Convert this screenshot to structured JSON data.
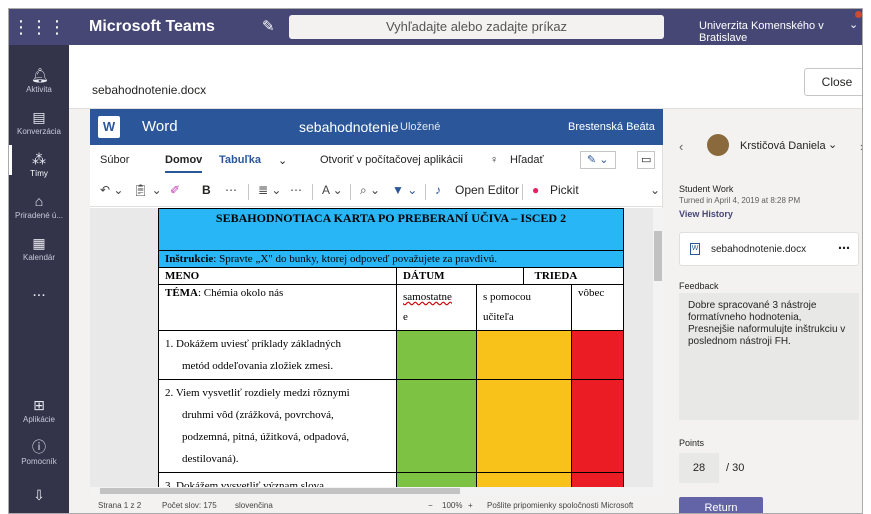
{
  "topbar": {
    "app_title": "Microsoft Teams",
    "search_placeholder": "Vyhľadajte alebo zadajte príkaz",
    "org_name": "Univerzita Komenského v Bratislave"
  },
  "rail": [
    {
      "label": "Aktivita",
      "icon": "bell-icon"
    },
    {
      "label": "Konverzácia",
      "icon": "chat-icon"
    },
    {
      "label": "Tímy",
      "icon": "teams-icon"
    },
    {
      "label": "Priradené ú...",
      "icon": "assignments-icon"
    },
    {
      "label": "Kalendár",
      "icon": "calendar-icon"
    },
    {
      "label": "...",
      "icon": "more-icon"
    },
    {
      "label": "Aplikácie",
      "icon": "apps-icon"
    },
    {
      "label": "Pomocník",
      "icon": "help-icon"
    }
  ],
  "file_header": {
    "filename": "sebahodnotenie.docx",
    "close_label": "Close"
  },
  "word": {
    "app_name": "Word",
    "doc_name": "sebahodnotenie",
    "saved_state": "Uložené",
    "user_name": "Brestenská Beáta",
    "menu": {
      "file": "Súbor",
      "home": "Domov",
      "table": "Tabuľka",
      "open_desktop": "Otvoriť v počítačovej aplikácii",
      "search": "Hľadať"
    },
    "toolbar": {
      "bold": "B",
      "open_editor": "Open Editor",
      "pickit": "Pickit"
    },
    "status": {
      "page": "Strana 1 z 2",
      "words": "Počet slov: 175",
      "language": "slovenčina",
      "zoom": "100%",
      "feedback": "Pošlite pripomienky spoločnosti Microsoft"
    }
  },
  "doc": {
    "title": "SEBAHODNOTIACA KARTA PO PREBERANÍ UČIVA – ISCED 2",
    "instruction_label": "Inštrukcie",
    "instruction_text": ": Spravte „X\" do bunky, ktorej odpoveď považujete za pravdivú.",
    "name_label": "MENO",
    "date_label": "DÁTUM",
    "class_label": "TRIEDA",
    "topic_label": "TÉMA",
    "topic_text": ": Chémia okolo nás",
    "col_self": "samostatne",
    "col_self_cont": "e",
    "col_help": "s pomocou",
    "col_help_cont": "učiteľa",
    "col_none": "vôbec",
    "items": [
      {
        "num": "1.",
        "text_lines": [
          "Dokážem uviesť príklady základných",
          "metód oddeľovania zložiek zmesi."
        ]
      },
      {
        "num": "2.",
        "text_lines": [
          "Viem vysvetliť rozdiely medzi rôznymi",
          "druhmi vôd (zrážková, povrchová,",
          "podzemná, pitná, úžitková, odpadová,",
          "destilovaná)."
        ]
      },
      {
        "num": "3.",
        "text_lines": [
          "Dokážem vysvetliť význam slova"
        ]
      }
    ]
  },
  "panel": {
    "student_name": "Krstičová Daniela",
    "student_work_label": "Student Work",
    "turned_in": "Turned in April 4, 2019 at 8:28 PM",
    "view_history": "View History",
    "file_name": "sebahodnotenie.docx",
    "feedback_label": "Feedback",
    "feedback_text": "Dobre spracované 3 nástroje formatívneho hodnotenia, Presnejšie naformulujte inštrukciu v poslednom nástroji FH.",
    "points_label": "Points",
    "points_value": "28",
    "points_total": "/ 30",
    "return_label": "Return"
  },
  "colors": {
    "teams_purple": "#464775",
    "word_blue": "#2b579a",
    "table_head": "#29b6f6",
    "green": "#7dc242",
    "yellow": "#f9c21a",
    "red": "#ec1c24"
  }
}
